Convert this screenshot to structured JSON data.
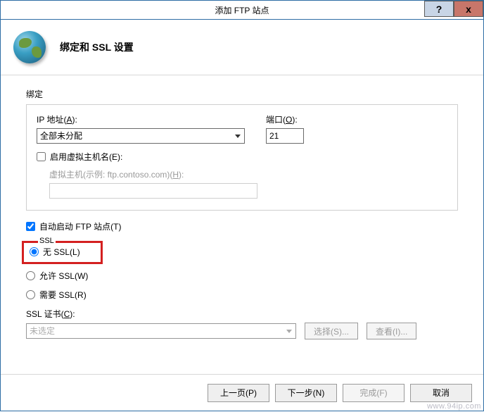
{
  "title_bar": {
    "title": "添加 FTP 站点",
    "help": "?",
    "close": "x"
  },
  "header": {
    "title": "绑定和 SSL 设置"
  },
  "binding": {
    "group_title": "绑定",
    "ip_label_pre": "IP 地址(",
    "ip_label_key": "A",
    "ip_label_post": "):",
    "ip_value": "全部未分配",
    "port_label_pre": "端口(",
    "port_label_key": "O",
    "port_label_post": "):",
    "port_value": "21",
    "vhost_enable_pre": "启用虚拟主机名(",
    "vhost_enable_key": "E",
    "vhost_enable_post": "):",
    "vhost_label_pre": "虚拟主机(示例: ftp.contoso.com)(",
    "vhost_label_key": "H",
    "vhost_label_post": "):",
    "vhost_value": ""
  },
  "autostart": {
    "label_pre": "自动启动 FTP 站点(",
    "label_key": "T",
    "label_post": ")"
  },
  "ssl": {
    "truncated_header": "SSL",
    "none_pre": "无 SSL(",
    "none_key": "L",
    "none_post": ")",
    "allow_pre": "允许 SSL(",
    "allow_key": "W",
    "allow_post": ")",
    "require_pre": "需要 SSL(",
    "require_key": "R",
    "require_post": ")",
    "cert_label_pre": "SSL 证书(",
    "cert_label_key": "C",
    "cert_label_post": "):",
    "cert_value": "未选定",
    "select_btn_pre": "选择(",
    "select_btn_key": "S",
    "select_btn_post": ")...",
    "view_btn_pre": "查看(",
    "view_btn_key": "I",
    "view_btn_post": ")..."
  },
  "footer": {
    "prev_pre": "上一页(",
    "prev_key": "P",
    "prev_post": ")",
    "next_pre": "下一步(",
    "next_key": "N",
    "next_post": ")",
    "finish_pre": "完成(",
    "finish_key": "F",
    "finish_post": ")",
    "cancel": "取消"
  },
  "watermark": "www.94ip.com"
}
